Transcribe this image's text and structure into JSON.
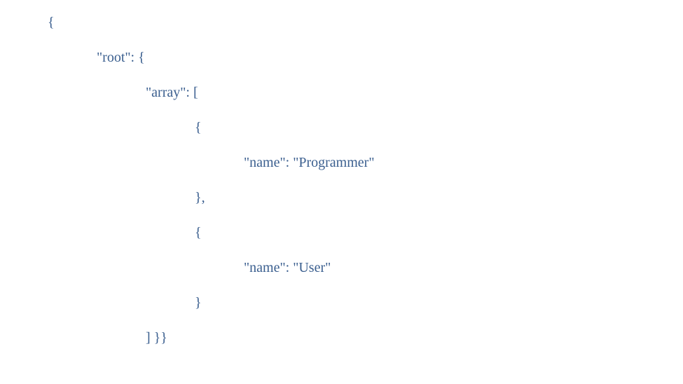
{
  "lines": [
    {
      "indent": "indent-0",
      "text": "{"
    },
    {
      "indent": "indent-1",
      "text": "\"root\": {"
    },
    {
      "indent": "indent-2",
      "text": "\"array\": ["
    },
    {
      "indent": "indent-3",
      "text": "{"
    },
    {
      "indent": "indent-4",
      "text": "\"name\": \"Programmer\""
    },
    {
      "indent": "indent-3",
      "text": "},"
    },
    {
      "indent": "indent-3",
      "text": "{"
    },
    {
      "indent": "indent-4",
      "text": "\"name\": \"User\""
    },
    {
      "indent": "indent-3",
      "text": "}"
    },
    {
      "indent": "indent-2",
      "text": "] }}"
    }
  ],
  "json_value": {
    "root": {
      "array": [
        {
          "name": "Programmer"
        },
        {
          "name": "User"
        }
      ]
    }
  }
}
